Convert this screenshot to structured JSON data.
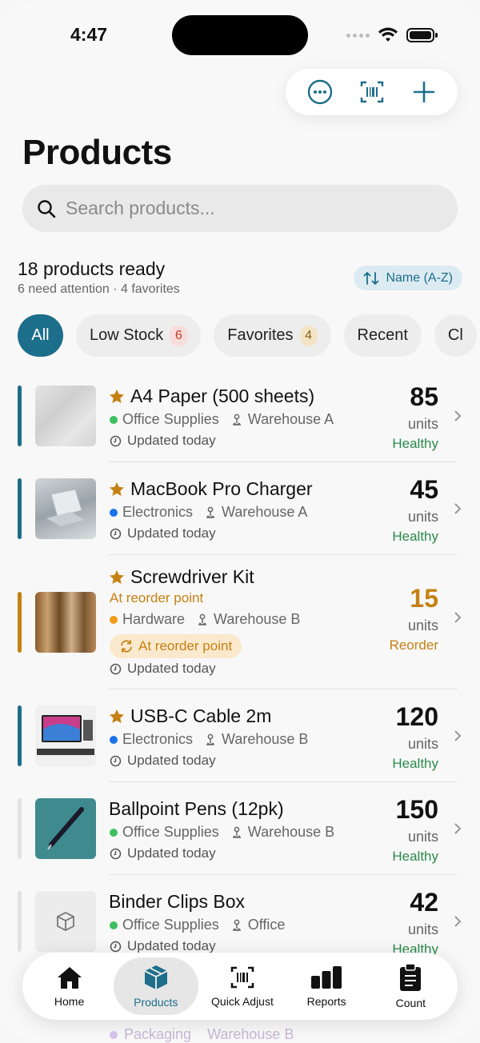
{
  "status": {
    "time": "4:47"
  },
  "toolbar": {
    "more_icon": "ellipsis-circle-icon",
    "scan_icon": "barcode-scan-icon",
    "add_icon": "plus-icon"
  },
  "page": {
    "title": "Products"
  },
  "search": {
    "placeholder": "Search products..."
  },
  "summary": {
    "title": "18 products ready",
    "subtitle": "6 need attention · 4 favorites"
  },
  "sort": {
    "label": "Name (A-Z)"
  },
  "filters": [
    {
      "label": "All",
      "count": ""
    },
    {
      "label": "Low Stock",
      "count": "6"
    },
    {
      "label": "Favorites",
      "count": "4"
    },
    {
      "label": "Recent",
      "count": ""
    },
    {
      "label": "Cl",
      "count": ""
    }
  ],
  "products": [
    {
      "name": "A4 Paper (500 sheets)",
      "favorite": true,
      "category": "Office Supplies",
      "location": "Warehouse A",
      "updated": "Updated today",
      "qty": "85",
      "units": "units",
      "state": "Healthy",
      "accent": "#1d6e8b",
      "cat_color": "#3fbf5f"
    },
    {
      "name": "MacBook Pro Charger",
      "favorite": true,
      "category": "Electronics",
      "location": "Warehouse A",
      "updated": "Updated today",
      "qty": "45",
      "units": "units",
      "state": "Healthy",
      "accent": "#1d6e8b",
      "cat_color": "#1a73e8"
    },
    {
      "name": "Screwdriver Kit",
      "favorite": true,
      "alert": "At reorder point",
      "badge": "At reorder point",
      "category": "Hardware",
      "location": "Warehouse B",
      "updated": "Updated today",
      "qty": "15",
      "units": "units",
      "state": "Reorder",
      "accent": "#c58114",
      "cat_color": "#f29a18"
    },
    {
      "name": "USB-C Cable 2m",
      "favorite": true,
      "category": "Electronics",
      "location": "Warehouse B",
      "updated": "Updated today",
      "qty": "120",
      "units": "units",
      "state": "Healthy",
      "accent": "#1d6e8b",
      "cat_color": "#1a73e8"
    },
    {
      "name": "Ballpoint Pens (12pk)",
      "favorite": false,
      "category": "Office Supplies",
      "location": "Warehouse B",
      "updated": "Updated today",
      "qty": "150",
      "units": "units",
      "state": "Healthy",
      "accent": "#e2e2e2",
      "cat_color": "#3fbf5f"
    },
    {
      "name": "Binder Clips Box",
      "favorite": false,
      "category": "Office Supplies",
      "location": "Office",
      "updated": "Updated today",
      "qty": "42",
      "units": "units",
      "state": "Healthy",
      "accent": "#e2e2e2",
      "cat_color": "#3fbf5f"
    }
  ],
  "peek": {
    "category": "Packaging",
    "location": "Warehouse B"
  },
  "tabs": [
    {
      "label": "Home",
      "icon": "house-icon"
    },
    {
      "label": "Products",
      "icon": "box-icon"
    },
    {
      "label": "Quick Adjust",
      "icon": "barcode-scan-icon"
    },
    {
      "label": "Reports",
      "icon": "bar-chart-icon"
    },
    {
      "label": "Count",
      "icon": "clipboard-icon"
    }
  ],
  "colors": {
    "accent": "#1d6e8b",
    "healthy": "#2a8a4a",
    "reorder": "#c58114"
  }
}
